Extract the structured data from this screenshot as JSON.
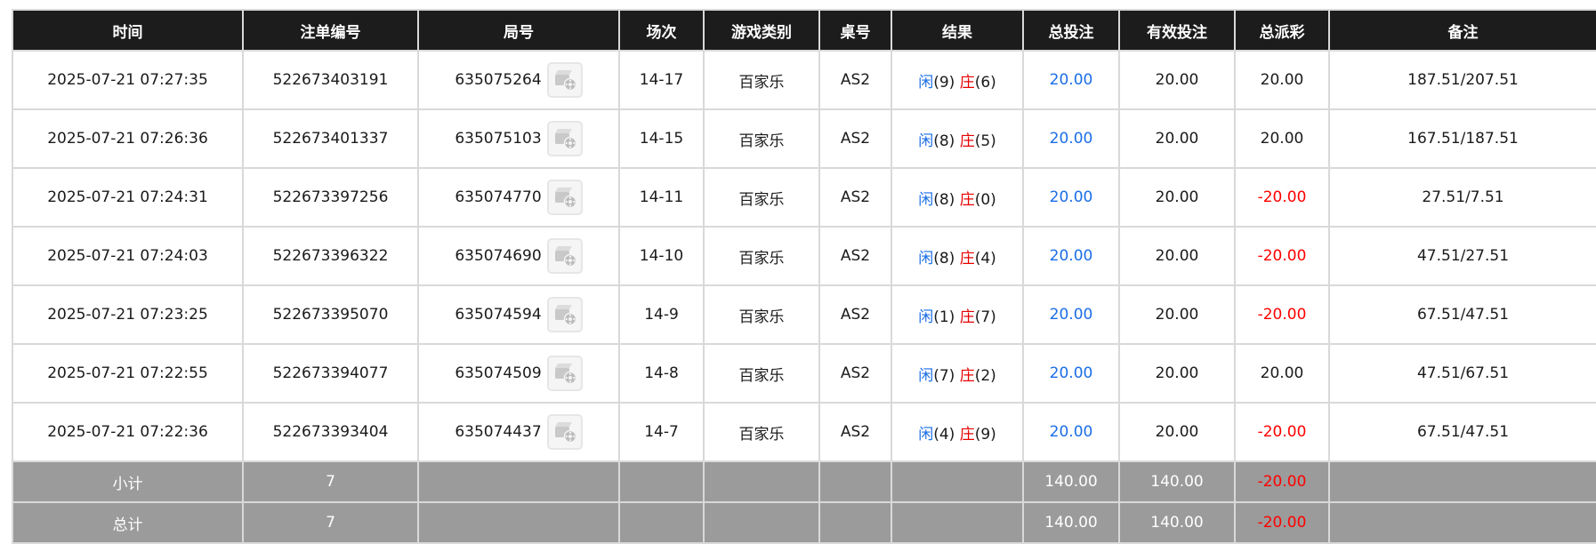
{
  "headers": [
    "时间",
    "注单编号",
    "局号",
    "场次",
    "游戏类别",
    "桌号",
    "结果",
    "总投注",
    "有效投注",
    "总派彩",
    "备注"
  ],
  "rows": [
    {
      "time": "2025-07-21 07:27:35",
      "bet_no": "522673403191",
      "round": "635075264",
      "session": "14-17",
      "game": "百家乐",
      "table": "AS2",
      "player_label": "闲",
      "player_pts": "(9)",
      "banker_label": "庄",
      "banker_pts": "(6)",
      "total_bet": "20.00",
      "valid_bet": "20.00",
      "payout": "20.00",
      "payout_negative": false,
      "note": "187.51/207.51"
    },
    {
      "time": "2025-07-21 07:26:36",
      "bet_no": "522673401337",
      "round": "635075103",
      "session": "14-15",
      "game": "百家乐",
      "table": "AS2",
      "player_label": "闲",
      "player_pts": "(8)",
      "banker_label": "庄",
      "banker_pts": "(5)",
      "total_bet": "20.00",
      "valid_bet": "20.00",
      "payout": "20.00",
      "payout_negative": false,
      "note": "167.51/187.51"
    },
    {
      "time": "2025-07-21 07:24:31",
      "bet_no": "522673397256",
      "round": "635074770",
      "session": "14-11",
      "game": "百家乐",
      "table": "AS2",
      "player_label": "闲",
      "player_pts": "(8)",
      "banker_label": "庄",
      "banker_pts": "(0)",
      "total_bet": "20.00",
      "valid_bet": "20.00",
      "payout": "-20.00",
      "payout_negative": true,
      "note": "27.51/7.51"
    },
    {
      "time": "2025-07-21 07:24:03",
      "bet_no": "522673396322",
      "round": "635074690",
      "session": "14-10",
      "game": "百家乐",
      "table": "AS2",
      "player_label": "闲",
      "player_pts": "(8)",
      "banker_label": "庄",
      "banker_pts": "(4)",
      "total_bet": "20.00",
      "valid_bet": "20.00",
      "payout": "-20.00",
      "payout_negative": true,
      "note": "47.51/27.51"
    },
    {
      "time": "2025-07-21 07:23:25",
      "bet_no": "522673395070",
      "round": "635074594",
      "session": "14-9",
      "game": "百家乐",
      "table": "AS2",
      "player_label": "闲",
      "player_pts": "(1)",
      "banker_label": "庄",
      "banker_pts": "(7)",
      "total_bet": "20.00",
      "valid_bet": "20.00",
      "payout": "-20.00",
      "payout_negative": true,
      "note": "67.51/47.51"
    },
    {
      "time": "2025-07-21 07:22:55",
      "bet_no": "522673394077",
      "round": "635074509",
      "session": "14-8",
      "game": "百家乐",
      "table": "AS2",
      "player_label": "闲",
      "player_pts": "(7)",
      "banker_label": "庄",
      "banker_pts": "(2)",
      "total_bet": "20.00",
      "valid_bet": "20.00",
      "payout": "20.00",
      "payout_negative": false,
      "note": "47.51/67.51"
    },
    {
      "time": "2025-07-21 07:22:36",
      "bet_no": "522673393404",
      "round": "635074437",
      "session": "14-7",
      "game": "百家乐",
      "table": "AS2",
      "player_label": "闲",
      "player_pts": "(4)",
      "banker_label": "庄",
      "banker_pts": "(9)",
      "total_bet": "20.00",
      "valid_bet": "20.00",
      "payout": "-20.00",
      "payout_negative": true,
      "note": "67.51/47.51"
    }
  ],
  "subtotal": {
    "label": "小计",
    "count": "7",
    "total_bet": "140.00",
    "valid_bet": "140.00",
    "payout": "-20.00"
  },
  "grandtotal": {
    "label": "总计",
    "count": "7",
    "total_bet": "140.00",
    "valid_bet": "140.00",
    "payout": "-20.00"
  },
  "icons": {
    "replay": "video-replay-icon"
  },
  "colors": {
    "header_bg": "#1c1c1c",
    "footer_bg": "#9b9b9b",
    "player": "#1a6ee6",
    "banker": "#e60000",
    "negative": "#ff0000"
  }
}
